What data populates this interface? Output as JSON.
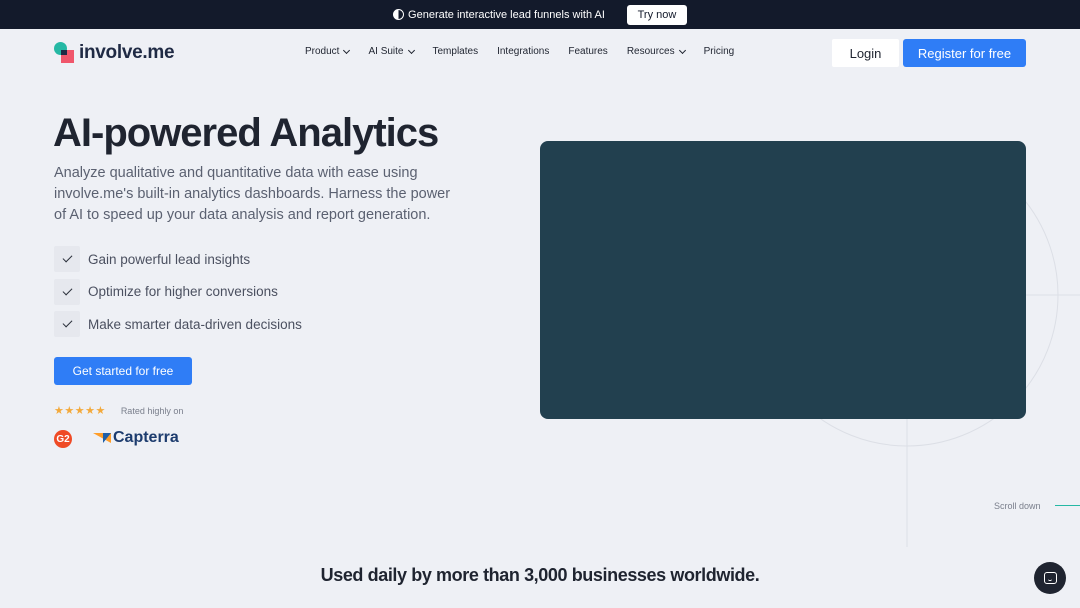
{
  "announcement": {
    "icon": "ai-spark-icon",
    "message": "Generate interactive lead funnels with AI",
    "cta_label": "Try now"
  },
  "nav": {
    "logo_text": "involve.me",
    "menu": [
      {
        "label": "Product",
        "has_dropdown": true
      },
      {
        "label": "AI Suite",
        "has_dropdown": true
      },
      {
        "label": "Templates",
        "has_dropdown": false
      },
      {
        "label": "Integrations",
        "has_dropdown": false
      },
      {
        "label": "Features",
        "has_dropdown": false
      },
      {
        "label": "Resources",
        "has_dropdown": true
      },
      {
        "label": "Pricing",
        "has_dropdown": false
      }
    ],
    "login_label": "Login",
    "register_label": "Register for free"
  },
  "hero": {
    "title": "AI-powered Analytics",
    "description": "Analyze qualitative and quantitative data with ease using involve.me's built-in analytics dashboards. Harness the power of AI to speed up your data analysis and report generation.",
    "features": [
      "Gain powerful lead insights",
      "Optimize for higher conversions",
      "Make smarter data-driven decisions"
    ],
    "cta_label": "Get started for free",
    "rating_stars": "★★★★★",
    "rating_value": 4.5,
    "rated_text": "Rated highly on",
    "review_sites": [
      "G2",
      "Capterra"
    ]
  },
  "media": {
    "color": "#22404f"
  },
  "scroll_label": "Scroll down",
  "bottom_title": "Used daily by more than 3,000 businesses worldwide.",
  "colors": {
    "accent": "#2f7df6",
    "dark": "#131a2b",
    "teal": "#25b8a4",
    "coral": "#f0566b",
    "background": "#eef0f5"
  }
}
